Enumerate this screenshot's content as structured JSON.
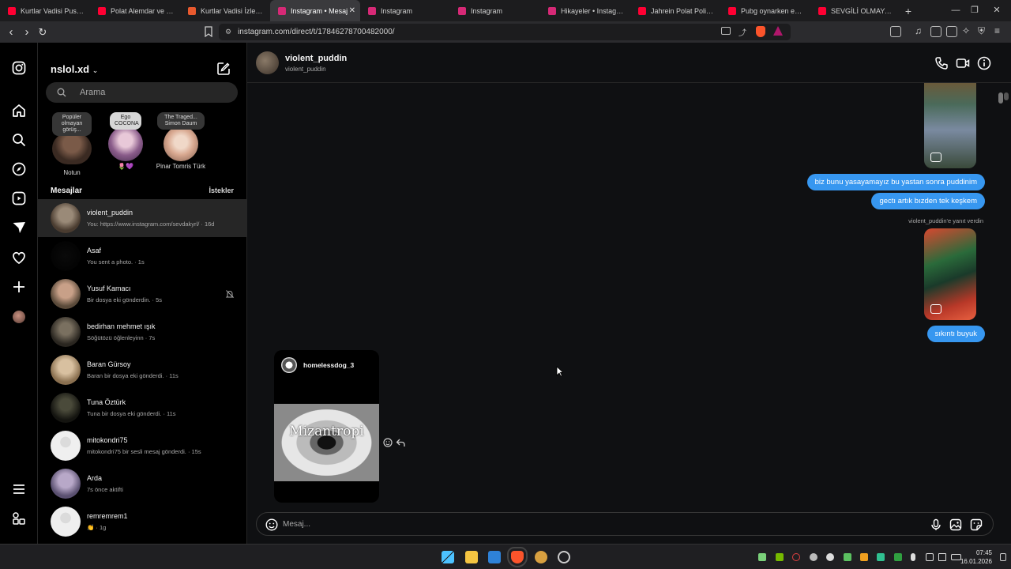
{
  "browser": {
    "tabs": [
      {
        "label": "Kurtlar Vadisi Pusu | 10",
        "color": "#ff0033",
        "active": false
      },
      {
        "label": "Polat Alemdar ve Elif Sa",
        "color": "#ff0033",
        "active": false
      },
      {
        "label": "Kurtlar Vadisi İzleme Si",
        "color": "#e8592e",
        "active": false
      },
      {
        "label": "Instagram • Mesaj",
        "color": "#d62976",
        "active": true
      },
      {
        "label": "Instagram",
        "color": "#d62976",
        "active": false
      },
      {
        "label": "Instagram",
        "color": "#d62976",
        "active": false
      },
      {
        "label": "Hikayeler • Instagram",
        "color": "#d62976",
        "active": false
      },
      {
        "label": "Jahrein Polat Polislerde",
        "color": "#ff0033",
        "active": false
      },
      {
        "label": "Pubg oynarken emmi",
        "color": "#ff0033",
        "active": false
      },
      {
        "label": "SEVGİLİ OLMAYALIM Ş",
        "color": "#ff0033",
        "active": false
      }
    ],
    "new_tab": "+",
    "url": "instagram.com/direct/t/17846278700482000/"
  },
  "sidebar": {
    "account": "nslol.xd",
    "search_placeholder": "Arama",
    "notes": [
      {
        "bubble": "Popüler olmayan görüş...",
        "name": "Notun"
      },
      {
        "bubble": "Ego COCONA",
        "name": "🌷💜"
      },
      {
        "bubble": "The Traged... Simon Daum",
        "name": "Pinar Tomris Türk"
      }
    ],
    "messages_title": "Mesajlar",
    "requests_label": "İstekler",
    "conversations": [
      {
        "name": "violent_puddin",
        "preview": "You: https://www.instagram.com/sevdakyrl/ · 16d",
        "selected": true,
        "muted": false
      },
      {
        "name": "Asaf",
        "preview": "You sent a photo. · 1s",
        "selected": false,
        "muted": false
      },
      {
        "name": "Yusuf Kamacı",
        "preview": "Bir dosya eki gönderdin. · 5s",
        "selected": false,
        "muted": true
      },
      {
        "name": "bedirhan mehmet ışık",
        "preview": "Söğütözü öğlenleyinn · 7s",
        "selected": false,
        "muted": false
      },
      {
        "name": "Baran Gürsoy",
        "preview": "Baran bir dosya eki gönderdi. · 11s",
        "selected": false,
        "muted": false
      },
      {
        "name": "Tuna Öztürk",
        "preview": "Tuna bir dosya eki gönderdi. · 11s",
        "selected": false,
        "muted": false
      },
      {
        "name": "mitokondri75",
        "preview": "mitokondri75 bir sesli mesaj gönderdi. · 15s",
        "selected": false,
        "muted": false
      },
      {
        "name": "Arda",
        "preview": "7s önce aktifti",
        "selected": false,
        "muted": false
      },
      {
        "name": "remremrem1",
        "preview": "👏 · 1g",
        "selected": false,
        "muted": false
      }
    ]
  },
  "chat": {
    "name": "violent_puddin",
    "username": "violent_puddin",
    "messages": [
      {
        "text": "biz bunu yasayamayız bu yastan sonra puddinim"
      },
      {
        "text": "gectı artık bızden tek keşkem"
      },
      {
        "text": "sıkıntı buyuk"
      }
    ],
    "reply_note": "violent_puddin'e yanıt verdin",
    "shared_post": {
      "author": "homelessdog_3",
      "caption": "Mizantropi"
    },
    "composer_placeholder": "Mesaj..."
  },
  "taskbar": {
    "time": "07:45",
    "date": "16.01.2026"
  }
}
